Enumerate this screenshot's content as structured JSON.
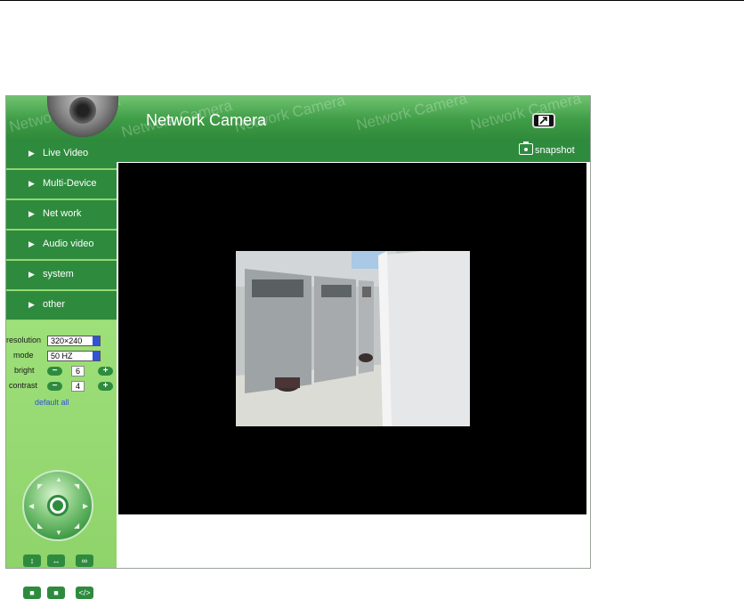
{
  "header": {
    "title": "Network Camera",
    "watermark": "Network Camera"
  },
  "toolbar": {
    "snapshot_label": "snapshot"
  },
  "sidebar": {
    "items": [
      {
        "label": "Live Video"
      },
      {
        "label": "Multi-Device"
      },
      {
        "label": "Net work"
      },
      {
        "label": "Audio video"
      },
      {
        "label": "system"
      },
      {
        "label": "other"
      }
    ]
  },
  "controls": {
    "resolution_label": "resolution",
    "resolution_value": "320×240",
    "mode_label": "mode",
    "mode_value": "50 HZ",
    "bright_label": "bright",
    "bright_value": "6",
    "contrast_label": "contrast",
    "contrast_value": "4",
    "default_label": "default all"
  },
  "colors": {
    "header_green": "#3f9c46",
    "nav_green": "#2e8b3e",
    "sidebar_light": "#9ee07a",
    "link_blue": "#2f55d4"
  },
  "icons": [
    "camera-dome-logo",
    "fullscreen-icon",
    "snapshot-camera-icon",
    "ptz-joystick",
    "flip-vertical-icon",
    "mirror-horizontal-icon",
    "cruise-icon"
  ]
}
